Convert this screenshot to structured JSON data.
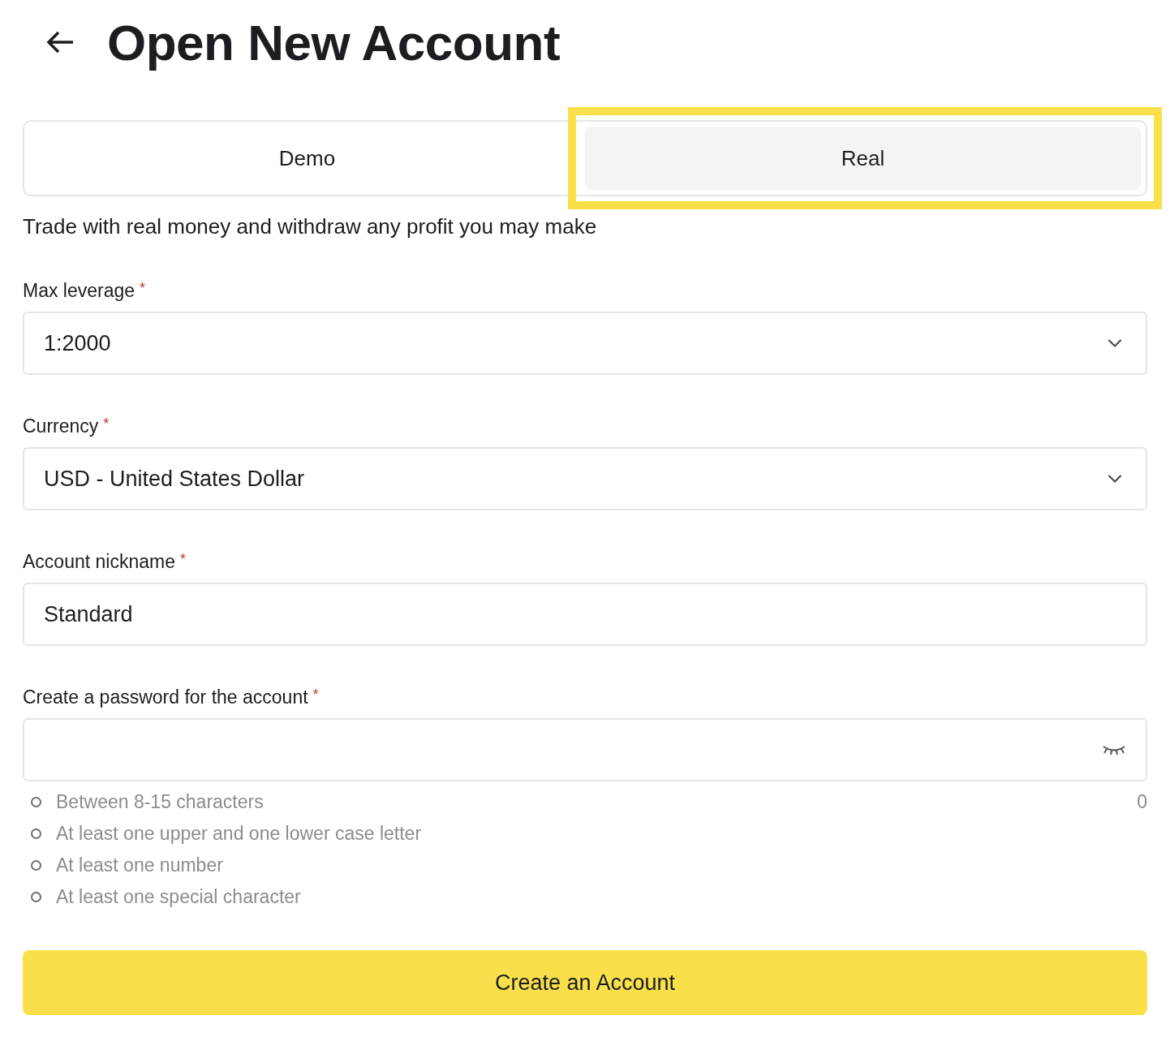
{
  "header": {
    "title": "Open New Account"
  },
  "tabs": [
    {
      "label": "Demo",
      "selected": false,
      "highlighted": false
    },
    {
      "label": "Real",
      "selected": true,
      "highlighted": true
    }
  ],
  "description": "Trade with real money and withdraw any profit you may make",
  "fields": [
    {
      "kind": "select",
      "label": "Max leverage",
      "required_mark": "*",
      "value": "1:2000"
    },
    {
      "kind": "select",
      "label": "Currency",
      "required_mark": "*",
      "value": "USD - United States Dollar"
    },
    {
      "kind": "text",
      "label": "Account nickname",
      "required_mark": "*",
      "value": "Standard"
    },
    {
      "kind": "password",
      "label": "Create a password for the account",
      "required_mark": "*",
      "counter": "0",
      "rules": [
        {
          "text": "Between 8-15 characters",
          "met": false
        },
        {
          "text": "At least one upper and one lower case letter",
          "met": false
        },
        {
          "text": "At least one number",
          "met": false
        },
        {
          "text": "At least one special character",
          "met": false
        }
      ]
    }
  ],
  "submit": "Create an Account"
}
